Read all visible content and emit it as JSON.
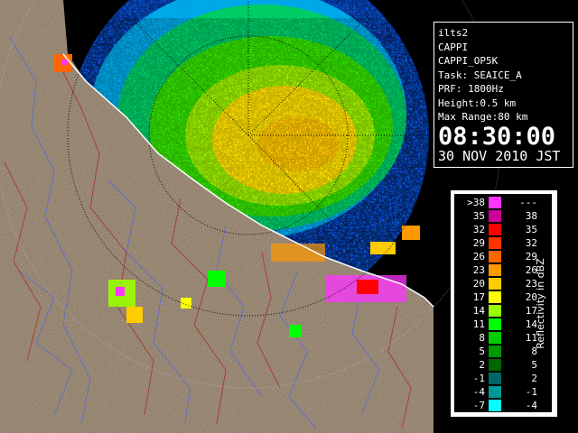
{
  "info": {
    "station": "ilts2",
    "product": "CAPPI",
    "product_name": "CAPPI_OP5K",
    "task": "Task: SEAICE_A",
    "prf": "PRF: 1800Hz",
    "height": "Height:0.5 km",
    "max_range": "Max Range:80 km",
    "time": "08:30:00",
    "date": "30 NOV 2010 JST"
  },
  "legend": {
    "title": "Reflectivity in dBZ",
    "rows": [
      {
        "lo": ">38",
        "hi": "---",
        "color": "#ff33ff"
      },
      {
        "lo": "35",
        "hi": "38",
        "color": "#cc0099"
      },
      {
        "lo": "32",
        "hi": "35",
        "color": "#ff0000"
      },
      {
        "lo": "29",
        "hi": "32",
        "color": "#ff3300"
      },
      {
        "lo": "26",
        "hi": "29",
        "color": "#ff6600"
      },
      {
        "lo": "23",
        "hi": "26",
        "color": "#ff9900"
      },
      {
        "lo": "20",
        "hi": "23",
        "color": "#ffcc00"
      },
      {
        "lo": "17",
        "hi": "20",
        "color": "#ffff00"
      },
      {
        "lo": "14",
        "hi": "17",
        "color": "#99ff00"
      },
      {
        "lo": "11",
        "hi": "14",
        "color": "#00ff00"
      },
      {
        "lo": "8",
        "hi": "11",
        "color": "#00cc00"
      },
      {
        "lo": "5",
        "hi": "8",
        "color": "#009900"
      },
      {
        "lo": "2",
        "hi": "5",
        "color": "#006600"
      },
      {
        "lo": "-1",
        "hi": "2",
        "color": "#006666"
      },
      {
        "lo": "-4",
        "hi": "-1",
        "color": "#009999"
      },
      {
        "lo": "-7",
        "hi": "-4",
        "color": "#00ffff"
      }
    ]
  },
  "map": {
    "colors": {
      "background": "#000000",
      "echo_floor": "#0066ff",
      "land": "#8a7358",
      "range_ring": "#000000"
    }
  }
}
